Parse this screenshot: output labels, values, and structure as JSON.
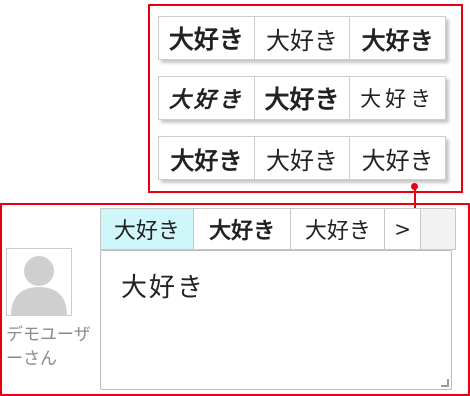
{
  "font_groups": [
    {
      "options": [
        "大好き",
        "大好き",
        "大好き"
      ]
    },
    {
      "options": [
        "大好き",
        "大好き",
        "大好き"
      ]
    },
    {
      "options": [
        "大好き",
        "大好き",
        "大好き"
      ]
    }
  ],
  "tabs": [
    "大好き",
    "大好き",
    "大好き"
  ],
  "next_glyph": ">",
  "user": {
    "name": "デモユーザーさん"
  },
  "editor": {
    "text": "大好き"
  },
  "colors": {
    "highlight_border": "#e60012",
    "active_tab": "#cff6f8",
    "name_text": "#8a8a8a"
  }
}
